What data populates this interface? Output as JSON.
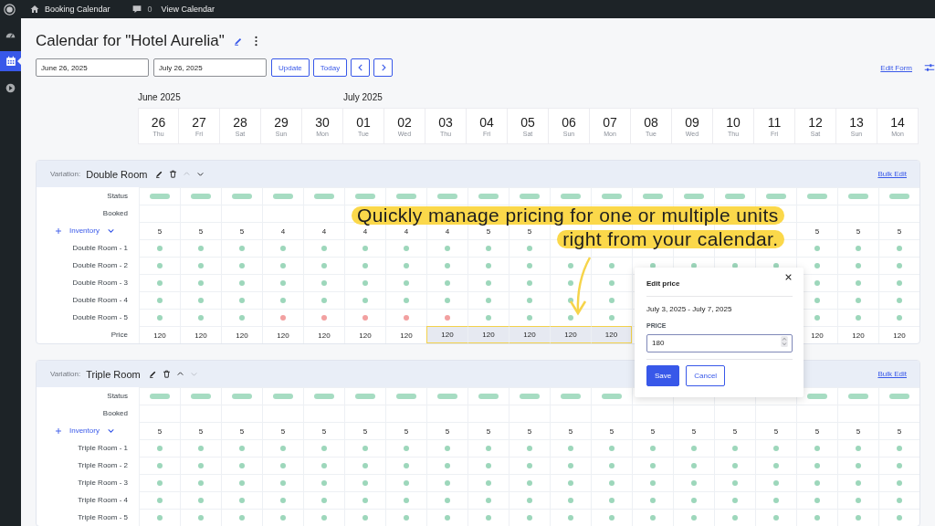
{
  "admin_bar": {
    "site": "Booking Calendar",
    "comments": "0",
    "link": "View Calendar"
  },
  "sidebar": {
    "items": [
      {
        "kind": "dashboard",
        "selected": false
      },
      {
        "kind": "calendar",
        "selected": true
      },
      {
        "kind": "media",
        "selected": false
      }
    ]
  },
  "page": {
    "title": "Calendar for \"Hotel Aurelia\""
  },
  "toolbar": {
    "start_date": "June 26, 2025",
    "end_date": "July 26, 2025",
    "buttons": [
      "Update",
      "Today"
    ],
    "edit_form": "Edit Form"
  },
  "days": [
    {
      "day": "26",
      "weekday": "Thu",
      "month": "June 2025"
    },
    {
      "day": "27",
      "weekday": "Fri"
    },
    {
      "day": "28",
      "weekday": "Sat"
    },
    {
      "day": "29",
      "weekday": "Sun"
    },
    {
      "day": "30",
      "weekday": "Mon"
    },
    {
      "day": "01",
      "weekday": "Tue",
      "month": "July 2025"
    },
    {
      "day": "02",
      "weekday": "Wed"
    },
    {
      "day": "03",
      "weekday": "Thu"
    },
    {
      "day": "04",
      "weekday": "Fri"
    },
    {
      "day": "05",
      "weekday": "Sat"
    },
    {
      "day": "06",
      "weekday": "Sun"
    },
    {
      "day": "07",
      "weekday": "Mon"
    },
    {
      "day": "08",
      "weekday": "Tue"
    },
    {
      "day": "09",
      "weekday": "Wed"
    },
    {
      "day": "10",
      "weekday": "Thu"
    },
    {
      "day": "11",
      "weekday": "Fri"
    },
    {
      "day": "12",
      "weekday": "Sat"
    },
    {
      "day": "13",
      "weekday": "Sun"
    },
    {
      "day": "14",
      "weekday": "Mon"
    }
  ],
  "variations": [
    {
      "label": "Variation:",
      "name": "Double Room",
      "up_disabled": true,
      "down_disabled": false,
      "bulk_edit": "Bulk Edit",
      "status_label": "Status",
      "booked_label": "Booked",
      "inventory_label": "Inventory",
      "price_label": "Price",
      "available": [
        true,
        true,
        true,
        true,
        true,
        true,
        true,
        true,
        true,
        true,
        true,
        true,
        true,
        true,
        true,
        true,
        true,
        true,
        true
      ],
      "inventory": [
        "5",
        "5",
        "5",
        "4",
        "4",
        "4",
        "4",
        "4",
        "5",
        "5"
      ],
      "inventory_end": [
        "5",
        "5",
        "5"
      ],
      "units": [
        {
          "name": "Double Room - 1",
          "booked": [
            false,
            false,
            false,
            false,
            false,
            false,
            false,
            false,
            false,
            false
          ],
          "booked_end": [
            false,
            false,
            false
          ]
        },
        {
          "name": "Double Room - 2",
          "booked": [
            false,
            false,
            false,
            false,
            false,
            false,
            false,
            false,
            false,
            false,
            false,
            false,
            false,
            false,
            false,
            false,
            false,
            false,
            false
          ]
        },
        {
          "name": "Double Room - 3",
          "booked": [
            false,
            false,
            false,
            false,
            false,
            false,
            false,
            false,
            false,
            false,
            false,
            false
          ],
          "booked_end": [
            false,
            false,
            false
          ]
        },
        {
          "name": "Double Room - 4",
          "booked": [
            false,
            false,
            false,
            false,
            false,
            false,
            false,
            false,
            false,
            false,
            false,
            false
          ],
          "booked_end": [
            false,
            false,
            false
          ]
        },
        {
          "name": "Double Room - 5",
          "booked": [
            false,
            false,
            false,
            true,
            true,
            true,
            true,
            true,
            false,
            false,
            false,
            false
          ],
          "booked_end": [
            false,
            false,
            false
          ]
        }
      ],
      "prices": [
        {
          "value": "120",
          "selected": false
        },
        {
          "value": "120",
          "selected": false
        },
        {
          "value": "120",
          "selected": false
        },
        {
          "value": "120",
          "selected": false
        },
        {
          "value": "120",
          "selected": false
        },
        {
          "value": "120",
          "selected": false
        },
        {
          "value": "120",
          "selected": false
        },
        {
          "value": "120",
          "selected": true
        },
        {
          "value": "120",
          "selected": true
        },
        {
          "value": "120",
          "selected": true
        },
        {
          "value": "120",
          "selected": true
        },
        {
          "value": "120",
          "selected": true
        }
      ],
      "prices_end": [
        {
          "value": "120",
          "selected": false
        },
        {
          "value": "120",
          "selected": false
        },
        {
          "value": "120",
          "selected": false
        }
      ]
    },
    {
      "label": "Variation:",
      "name": "Triple Room",
      "up_disabled": false,
      "down_disabled": true,
      "bulk_edit": "Bulk Edit",
      "status_label": "Status",
      "booked_label": "Booked",
      "inventory_label": "Inventory",
      "available": [
        true,
        true,
        true,
        true,
        true,
        true,
        true,
        true,
        true,
        true,
        true,
        true
      ],
      "available_end": [
        true,
        true,
        true
      ],
      "inventory": [
        "5",
        "5",
        "5",
        "5",
        "5",
        "5",
        "5",
        "5",
        "5",
        "5",
        "5",
        "5",
        "5",
        "5",
        "5",
        "5",
        "5",
        "5",
        "5"
      ],
      "units": [
        {
          "name": "Triple Room - 1",
          "booked": [
            false,
            false,
            false,
            false,
            false,
            false,
            false,
            false,
            false,
            false,
            false,
            false,
            false,
            false,
            false,
            false,
            false,
            false,
            false
          ]
        },
        {
          "name": "Triple Room - 2",
          "booked": [
            false,
            false,
            false,
            false,
            false,
            false,
            false,
            false,
            false,
            false,
            false,
            false,
            false,
            false,
            false,
            false,
            false,
            false,
            false
          ]
        },
        {
          "name": "Triple Room - 3",
          "booked": [
            false,
            false,
            false,
            false,
            false,
            false,
            false,
            false,
            false,
            false,
            false,
            false,
            false,
            false,
            false,
            false,
            false,
            false,
            false
          ]
        },
        {
          "name": "Triple Room - 4",
          "booked": [
            false,
            false,
            false,
            false,
            false,
            false,
            false,
            false,
            false,
            false,
            false,
            false,
            false,
            false,
            false,
            false,
            false,
            false,
            false
          ]
        },
        {
          "name": "Triple Room - 5",
          "booked": [
            false,
            false,
            false,
            false,
            false,
            false,
            false,
            false,
            false,
            false,
            false,
            false,
            false,
            false,
            false,
            false,
            false,
            false,
            false
          ]
        }
      ]
    }
  ],
  "popover": {
    "title": "Edit price",
    "range": "July 3, 2025 - July 7, 2025",
    "field_label": "PRICE",
    "value": "180",
    "buttons": [
      "Save",
      "Cancel"
    ]
  },
  "callout": {
    "lines": [
      "Quickly manage pricing for one or multiple units",
      "right from your calendar."
    ]
  }
}
